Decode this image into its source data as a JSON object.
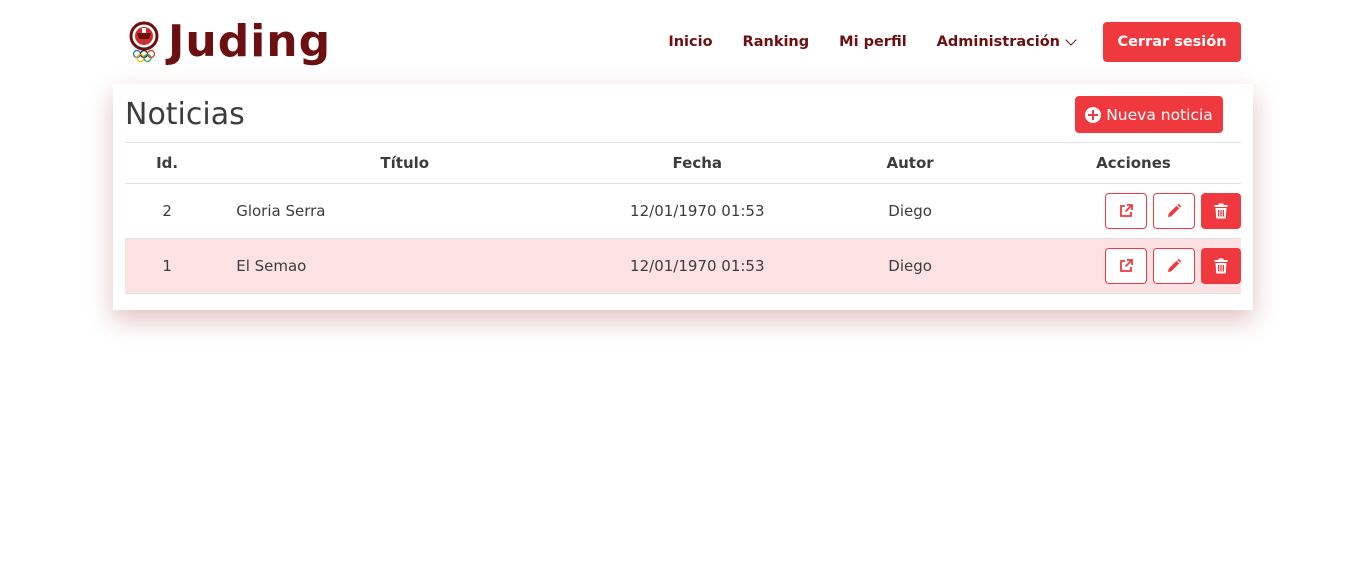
{
  "brand": {
    "name": "Juding",
    "logo_icon": "judo-emblem-icon"
  },
  "nav": {
    "items": [
      "Inicio",
      "Ranking",
      "Mi perfil"
    ],
    "admin_label": "Administración",
    "logout_label": "Cerrar sesión"
  },
  "page": {
    "title": "Noticias",
    "new_button_label": "Nueva noticia"
  },
  "table": {
    "headers": {
      "id": "Id.",
      "title": "Título",
      "date": "Fecha",
      "author": "Autor",
      "actions": "Acciones"
    },
    "rows": [
      {
        "id": "2",
        "title": "Gloria Serra",
        "date": "12/01/1970 01:53",
        "author": "Diego"
      },
      {
        "id": "1",
        "title": "El Semao",
        "date": "12/01/1970 01:53",
        "author": "Diego"
      }
    ],
    "action_icons": [
      "external-link-icon",
      "pencil-icon",
      "trash-icon"
    ]
  },
  "colors": {
    "brand": "#6b0f10",
    "accent": "#f0393e",
    "row_stripe": "#fde2e4"
  }
}
